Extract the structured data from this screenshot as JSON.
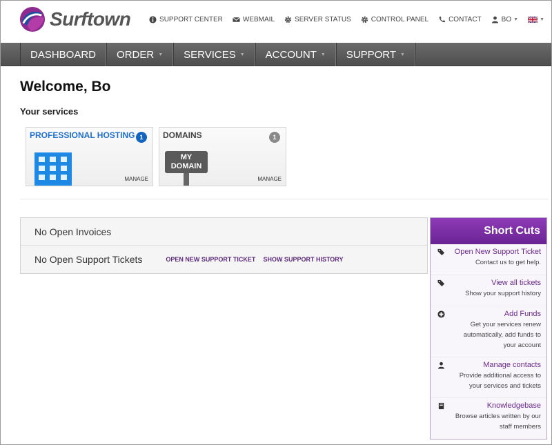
{
  "brand": {
    "name": "Surftown"
  },
  "topnav": {
    "support_center": "SUPPORT CENTER",
    "webmail": "WEBMAIL",
    "server_status": "SERVER STATUS",
    "control_panel": "CONTROL PANEL",
    "contact": "CONTACT",
    "user": "BO"
  },
  "mainnav": {
    "dashboard": "DASHBOARD",
    "order": "ORDER",
    "services": "SERVICES",
    "account": "ACCOUNT",
    "support": "SUPPORT"
  },
  "welcome": "Welcome, Bo",
  "services_label": "Your services",
  "services": [
    {
      "title": "PROFESSIONAL HOSTING",
      "count": "1",
      "manage": "MANAGE",
      "color": "#1565c0"
    },
    {
      "title": "DOMAINS",
      "count": "1",
      "manage": "MANAGE",
      "sign_line1": "MY",
      "sign_line2": "DOMAIN",
      "color": "#444444"
    }
  ],
  "status": {
    "invoices": "No Open Invoices",
    "tickets": "No Open Support Tickets",
    "open_ticket_link": "OPEN NEW SUPPORT TICKET",
    "history_link": "SHOW SUPPORT HISTORY"
  },
  "shortcuts": {
    "title": "Short Cuts",
    "items": [
      {
        "title": "Open New Support Ticket",
        "desc": [
          "Contact us to get help."
        ],
        "icon": "tags-icon"
      },
      {
        "title": "View all tickets",
        "desc": [
          "Show your support history"
        ],
        "icon": "tags-icon"
      },
      {
        "title": "Add Funds",
        "desc": [
          "Get your services renew",
          "automatically, add funds to",
          "your account"
        ],
        "icon": "plus-circle-icon"
      },
      {
        "title": "Manage contacts",
        "desc": [
          "Provide additional access to",
          "your services and tickets"
        ],
        "icon": "user-icon"
      },
      {
        "title": "Knowledgebase",
        "desc": [
          "Browse articles written by our",
          "staff members"
        ],
        "icon": "book-icon"
      }
    ]
  },
  "colors": {
    "accent": "#7b2fa8",
    "nav_bg": "#5a5a5a",
    "link": "#5b2a7a",
    "hosting_blue": "#1e88e5"
  }
}
